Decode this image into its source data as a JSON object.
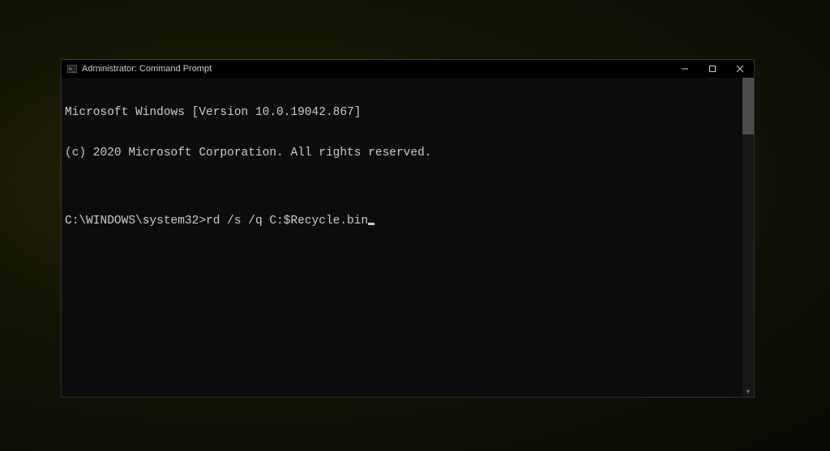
{
  "window": {
    "title": "Administrator: Command Prompt"
  },
  "terminal": {
    "line1": "Microsoft Windows [Version 10.0.19042.867]",
    "line2": "(c) 2020 Microsoft Corporation. All rights reserved.",
    "blank": "",
    "prompt": "C:\\WINDOWS\\system32>",
    "command": "rd /s /q C:$Recycle.bin"
  }
}
